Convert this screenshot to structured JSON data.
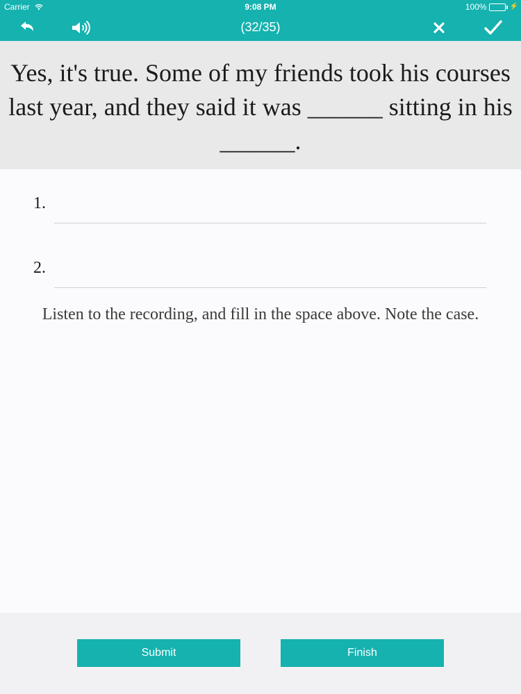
{
  "status_bar": {
    "carrier": "Carrier",
    "time": "9:08 PM",
    "battery": "100%",
    "battery_level": 1.0
  },
  "nav": {
    "progress": "(32/35)",
    "icons": {
      "back": "undo-arrow-icon",
      "audio": "speaker-icon",
      "close": "close-icon",
      "confirm": "checkmark-icon"
    }
  },
  "question": {
    "text": "Yes, it's true. Some of my friends took his courses last year, and they said it was ______ sitting in his ______."
  },
  "answers": [
    {
      "number": "1.",
      "value": "",
      "placeholder": ""
    },
    {
      "number": "2.",
      "value": "",
      "placeholder": ""
    }
  ],
  "instruction": "Listen to the recording, and fill in the space above. Note the case.",
  "buttons": {
    "submit": "Submit",
    "finish": "Finish"
  },
  "colors": {
    "accent": "#15b2af",
    "question_bg": "#e9e9ea",
    "page_bg": "#fbfbfd",
    "bottom_bg": "#f1f1f3"
  }
}
